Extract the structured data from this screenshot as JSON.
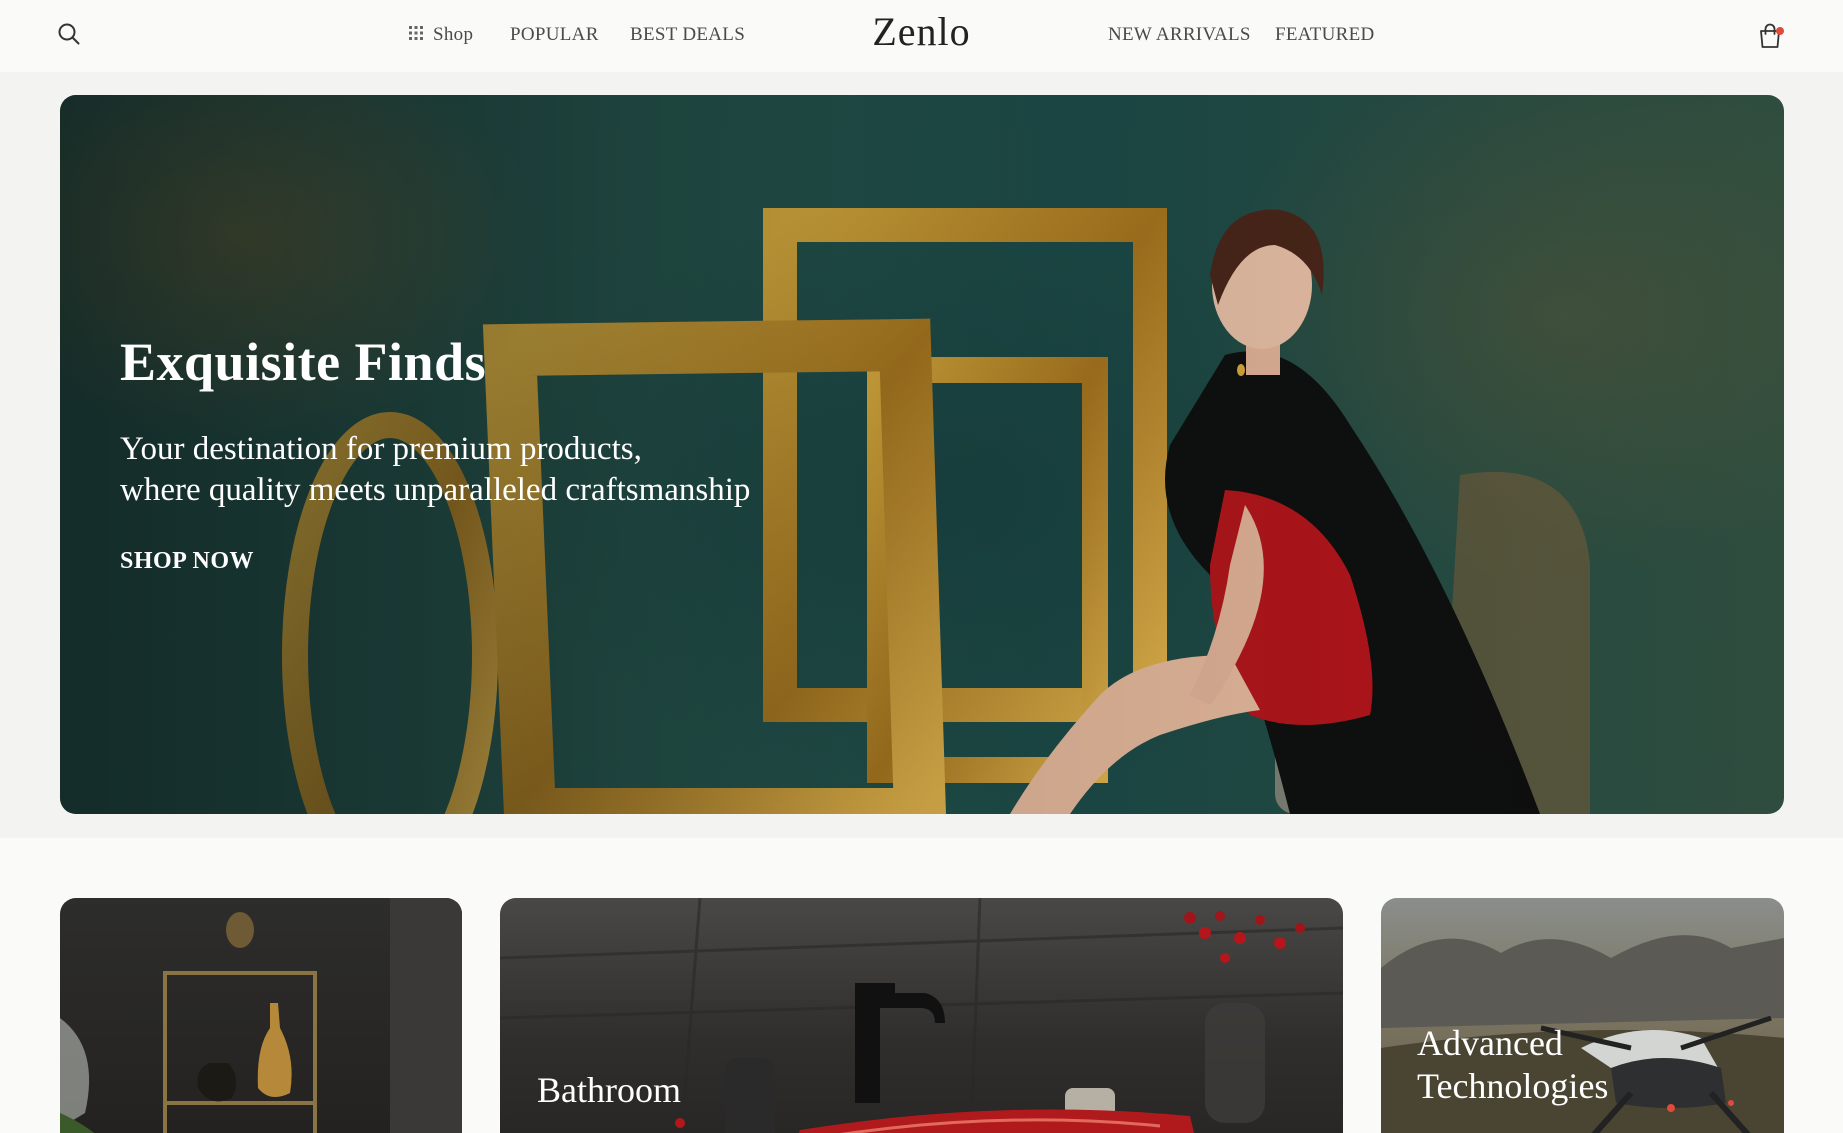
{
  "header": {
    "logo": "Zenlo",
    "nav_left": [
      {
        "label": "Shop",
        "icon": "grid-icon"
      },
      {
        "label": "POPULAR"
      },
      {
        "label": "BEST DEALS"
      }
    ],
    "nav_right": [
      {
        "label": "NEW ARRIVALS"
      },
      {
        "label": "FEATURED"
      }
    ],
    "search_icon": "search-icon",
    "cart_icon": "shopping-bag-icon",
    "cart_badge_color": "#e04a3c"
  },
  "hero": {
    "title": "Exquisite Finds",
    "subtitle_line1": "Your destination for premium products,",
    "subtitle_line2": "where quality meets unparalleled craftsmanship",
    "cta": "SHOP NOW"
  },
  "categories": [
    {
      "label": ""
    },
    {
      "label": "Bathroom"
    },
    {
      "label": "Advanced Technologies"
    }
  ],
  "colors": {
    "accent": "#e04a3c",
    "hero_text": "#ffffff"
  }
}
